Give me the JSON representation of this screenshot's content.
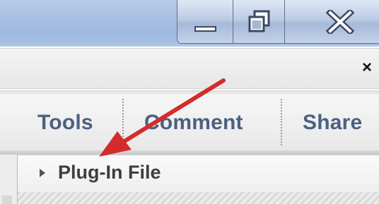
{
  "window_controls": {
    "minimize_icon": "minimize-icon",
    "restore_icon": "restore-icon",
    "close_icon": "close-icon"
  },
  "document_bar": {
    "close_label": "×"
  },
  "toolbar": {
    "items": [
      {
        "label": "Tools"
      },
      {
        "label": "Comment"
      },
      {
        "label": "Share"
      }
    ]
  },
  "panel": {
    "title": "Plug-In File",
    "expander_icon": "disclosure-triangle-icon"
  },
  "annotation": {
    "arrow_color": "#d42b2b"
  }
}
